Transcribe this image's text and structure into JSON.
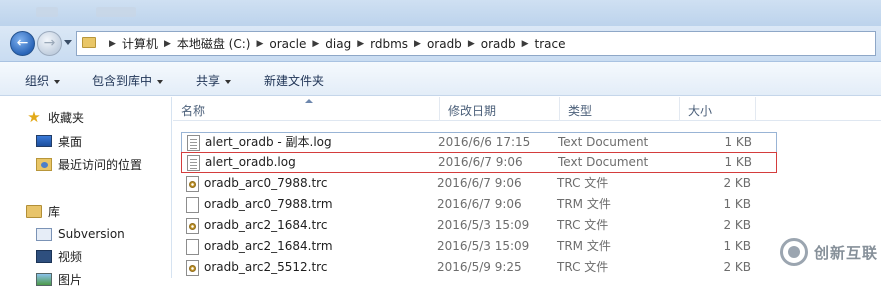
{
  "breadcrumb": [
    "计算机",
    "本地磁盘 (C:)",
    "oracle",
    "diag",
    "rdbms",
    "oradb",
    "oradb",
    "trace"
  ],
  "commands": [
    "组织",
    "包含到库中",
    "共享",
    "新建文件夹"
  ],
  "nav": {
    "favorites": "收藏夹",
    "desktop": "桌面",
    "recent": "最近访问的位置",
    "libraries": "库",
    "subversion": "Subversion",
    "videos": "视频",
    "pictures": "图片"
  },
  "columns": {
    "name": "名称",
    "date": "修改日期",
    "type": "类型",
    "size": "大小"
  },
  "files": [
    {
      "name": "alert_oradb - 副本.log",
      "date": "2016/6/6 17:15",
      "type": "Text Document",
      "size": "1 KB",
      "icon": "log-file-icon"
    },
    {
      "name": "alert_oradb.log",
      "date": "2016/6/7 9:06",
      "type": "Text Document",
      "size": "1 KB",
      "icon": "log-file-icon"
    },
    {
      "name": "oradb_arc0_7988.trc",
      "date": "2016/6/7 9:06",
      "type": "TRC 文件",
      "size": "2 KB",
      "icon": "trc-file-icon"
    },
    {
      "name": "oradb_arc0_7988.trm",
      "date": "2016/6/7 9:06",
      "type": "TRM 文件",
      "size": "1 KB",
      "icon": "trm-file-icon"
    },
    {
      "name": "oradb_arc2_1684.trc",
      "date": "2016/5/3 15:09",
      "type": "TRC 文件",
      "size": "2 KB",
      "icon": "trc-file-icon"
    },
    {
      "name": "oradb_arc2_1684.trm",
      "date": "2016/5/3 15:09",
      "type": "TRM 文件",
      "size": "1 KB",
      "icon": "trm-file-icon"
    },
    {
      "name": "oradb_arc2_5512.trc",
      "date": "2016/5/9 9:25",
      "type": "TRC 文件",
      "size": "2 KB",
      "icon": "trc-file-icon"
    }
  ],
  "watermark": "创新互联"
}
